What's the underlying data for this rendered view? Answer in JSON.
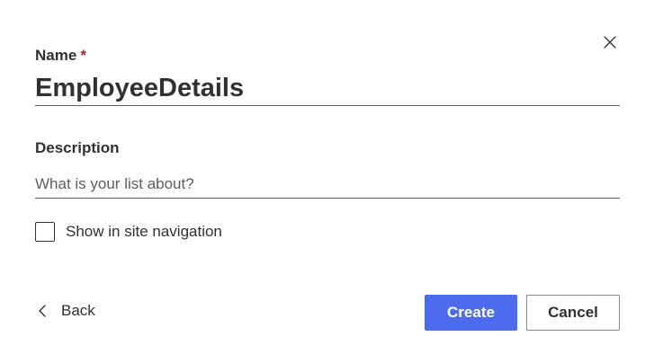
{
  "dialog": {
    "close_icon": "close-icon",
    "name": {
      "label": "Name",
      "required_marker": "*",
      "value": "EmployeeDetails"
    },
    "description": {
      "label": "Description",
      "value": "",
      "placeholder": "What is your list about?"
    },
    "show_in_navigation": {
      "label": "Show in site navigation",
      "checked": false
    },
    "footer": {
      "back_label": "Back",
      "back_icon": "chevron-left-icon",
      "create_label": "Create",
      "cancel_label": "Cancel"
    }
  },
  "colors": {
    "primary": "#4f6bed",
    "required": "#a4262c",
    "text": "#323130",
    "placeholder": "#605e5c"
  }
}
